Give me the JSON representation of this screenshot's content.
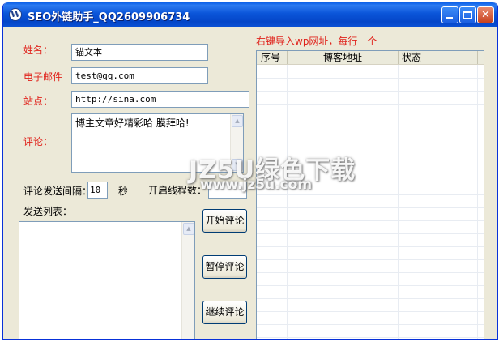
{
  "window": {
    "title": "SEO外链助手_QQ2609906734",
    "icon_letter": "W"
  },
  "form": {
    "name_label": "姓名：",
    "name_value": "锚文本",
    "email_label": "电子邮件",
    "email_value": "test@qq.com",
    "site_label": "站点：",
    "site_value": "http://sina.com",
    "comment_label": "评论：",
    "comment_value": "博主文章好精彩哈 膜拜哈!",
    "interval_label": "评论发送间隔：",
    "interval_value": "10",
    "interval_unit": "秒",
    "threads_label": "开启线程数：",
    "send_list_label": "发送列表："
  },
  "buttons": {
    "start": "开始评论",
    "pause": "暂停评论",
    "resume": "继续评论"
  },
  "blog_list": {
    "hint": "右键导入wp网址，每行一个",
    "columns": [
      "序号",
      "博客地址",
      "状态"
    ]
  },
  "watermark": {
    "line1": "JZ5U绿色下载",
    "line2": "www.jz5u.com"
  },
  "colors": {
    "label_red": "#e0231c",
    "titlebar_blue": "#0b55d9"
  }
}
